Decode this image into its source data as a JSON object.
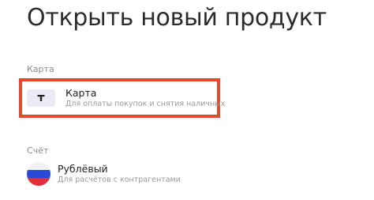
{
  "header": {
    "title": "Открыть новый продукт"
  },
  "sections": [
    {
      "label": "Карта",
      "items": [
        {
          "name": "Карта",
          "description": "Для оплаты покупок и снятия наличных",
          "icon": "card-icon",
          "highlighted": true,
          "highlight_color": "#e14a2c"
        }
      ]
    },
    {
      "label": "Счёт",
      "items": [
        {
          "name": "Рублёвый",
          "description": "Для расчётов с контрагентами",
          "icon": "russian-flag-icon",
          "highlighted": false
        }
      ]
    }
  ],
  "colors": {
    "accent_highlight": "#e14a2c",
    "icon_background": "#ece9f5",
    "flag_white": "#f2f2f2",
    "flag_blue": "#2a49d6",
    "flag_red": "#e52d3a"
  }
}
